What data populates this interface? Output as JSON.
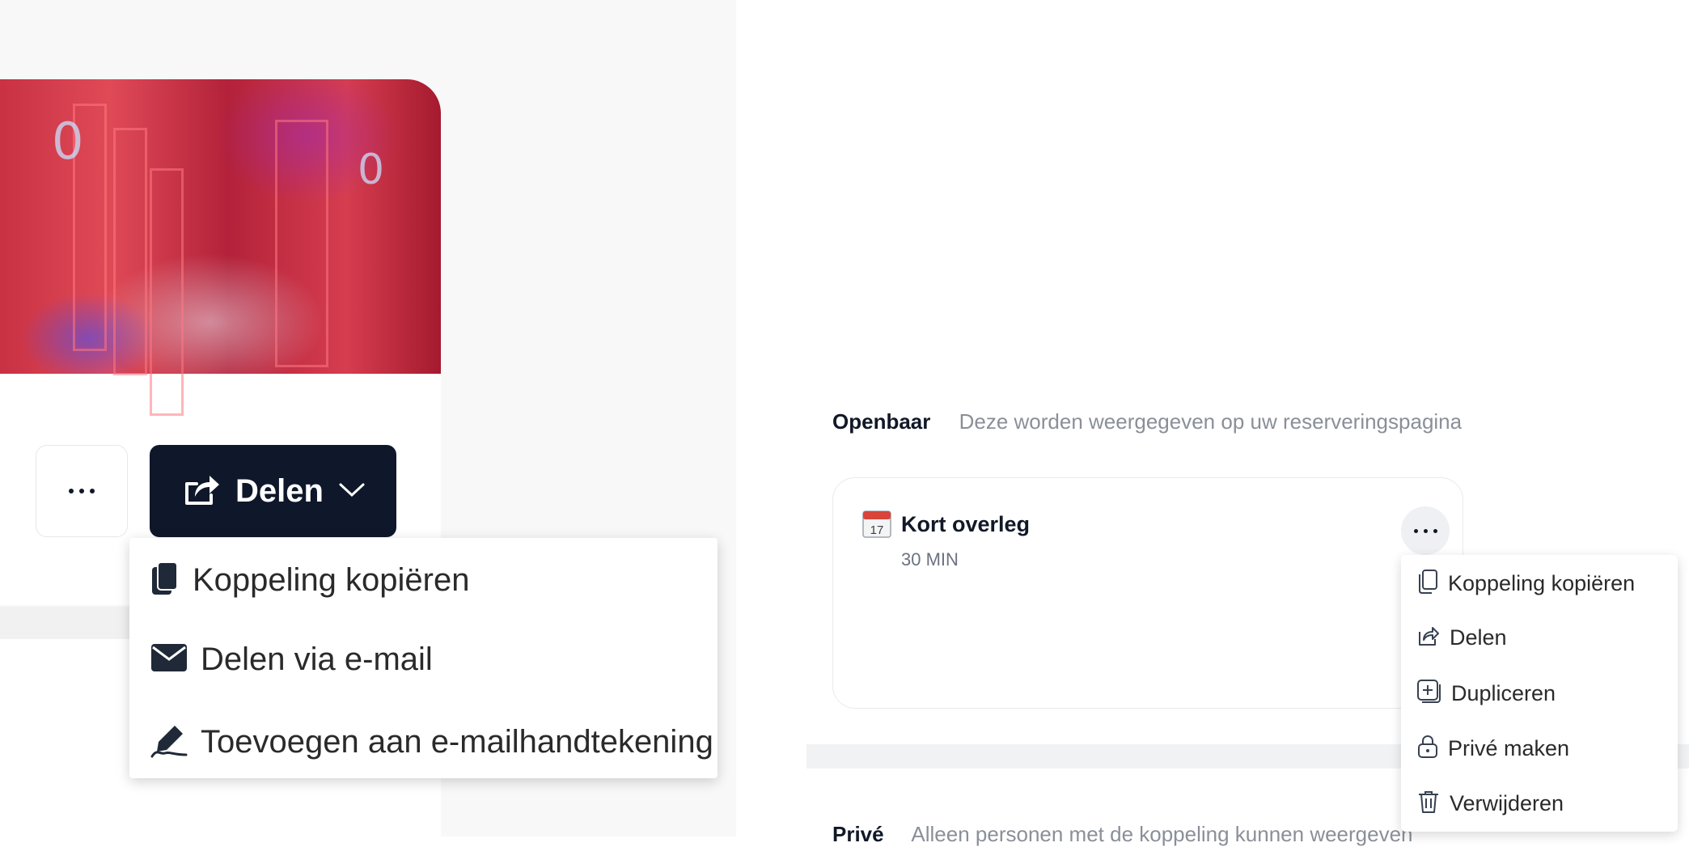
{
  "share_button": {
    "label": "Delen"
  },
  "share_menu": {
    "items": [
      {
        "label": "Koppeling kopiëren",
        "icon": "copy-icon"
      },
      {
        "label": "Delen via e-mail",
        "icon": "envelope-icon"
      },
      {
        "label": "Toevoegen aan e-mailhandtekening",
        "icon": "signature-icon"
      }
    ]
  },
  "hero": {
    "digits": [
      "0",
      "0"
    ]
  },
  "public_section": {
    "title": "Openbaar",
    "description": "Deze worden weergegeven op uw reserveringspagina"
  },
  "event": {
    "title": "Kort overleg",
    "duration": "30 MIN",
    "icon": "calendar-icon",
    "calendar_day": "17"
  },
  "event_menu": {
    "items": [
      {
        "label": "Koppeling kopiëren",
        "icon": "copy-icon"
      },
      {
        "label": "Delen",
        "icon": "share-icon"
      },
      {
        "label": "Dupliceren",
        "icon": "duplicate-icon"
      },
      {
        "label": "Privé maken",
        "icon": "lock-icon"
      },
      {
        "label": "Verwijderen",
        "icon": "trash-icon"
      }
    ]
  },
  "private_section": {
    "title": "Privé",
    "description": "Alleen personen met de koppeling kunnen weergeven"
  },
  "colors": {
    "primary_dark": "#0f172a",
    "muted_text": "#8a8f98",
    "calendar_red": "#d9453b"
  }
}
